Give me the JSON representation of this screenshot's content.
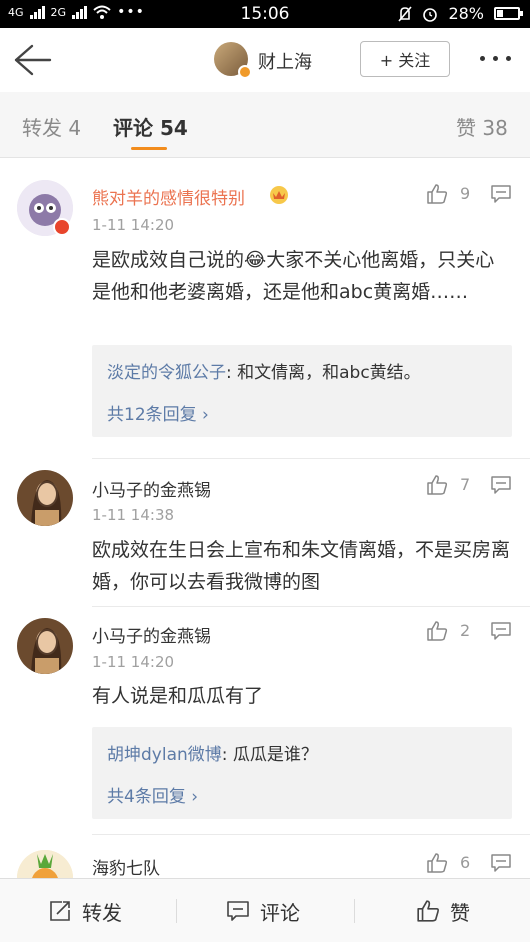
{
  "status_bar": {
    "network_1": "4G",
    "network_2": "2G",
    "time": "15:06",
    "battery": "28%",
    "battery_level": 0.28
  },
  "nav": {
    "title": "财上海",
    "follow_label": "+ 关注"
  },
  "tabs": {
    "repost": "转发 4",
    "comment": "评论 54",
    "like": "赞 38"
  },
  "comments": [
    {
      "name": "熊对羊的感情很特别",
      "time": "1-11 14:20",
      "text": "是欧成效自己说的😂大家不关心他离婚，只关心是他和他老婆离婚，还是他和abc黄离婚……",
      "likes": "9",
      "sub_author": "淡定的令狐公子",
      "sub_text": ": 和文倩离，和abc黄结。",
      "sub_more": "共12条回复 ›"
    },
    {
      "name": "小马子的金燕锡",
      "time": "1-11 14:38",
      "text": "欧成效在生日会上宣布和朱文倩离婚，不是买房离婚，你可以去看我微博的图",
      "likes": "7"
    },
    {
      "name": "小马子的金燕锡",
      "time": "1-11 14:20",
      "text": "有人说是和瓜瓜有了",
      "likes": "2",
      "sub_author": "胡坤dylan微博",
      "sub_text": ": 瓜瓜是谁？",
      "sub_more": "共4条回复 ›"
    },
    {
      "name": "海豹七队",
      "likes": "6"
    }
  ],
  "bottom_bar": {
    "repost": "转发",
    "comment": "评论",
    "like": "赞"
  },
  "colors": {
    "accent": "#f28c1c",
    "vip_name": "#eb7350",
    "link": "#5d7ba7"
  }
}
